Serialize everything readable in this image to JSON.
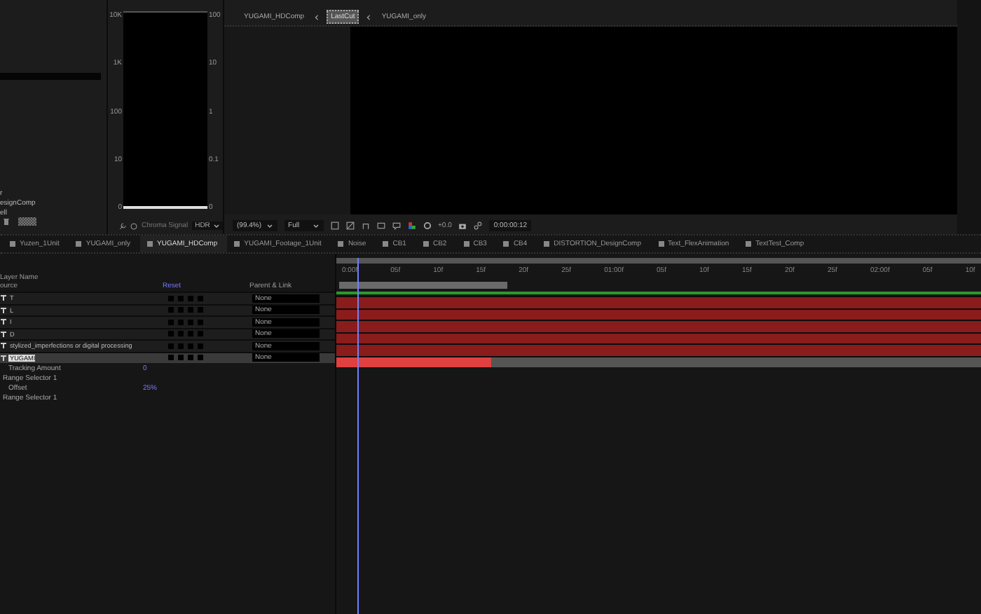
{
  "project_panel": {
    "items": [
      "r",
      "esignComp",
      "ell"
    ]
  },
  "scope": {
    "left_scale": [
      "10K",
      "1K",
      "100",
      "10",
      "0"
    ],
    "right_scale": [
      "100",
      "10",
      "1",
      "0.1",
      "0"
    ],
    "mode": "Chroma Signal",
    "range": "HDR"
  },
  "viewer": {
    "breadcrumbs": [
      {
        "label": "YUGAMI_HDComp",
        "selected": false
      },
      {
        "label": "LastCut",
        "selected": true
      },
      {
        "label": "YUGAMI_only",
        "selected": false
      }
    ],
    "zoom": "(99.4%)",
    "resolution": "Full",
    "exposure": "+0.0",
    "timecode": "0:00:00:12"
  },
  "comp_tabs": [
    {
      "label": "Yuzen_1Unit",
      "selected": false
    },
    {
      "label": "YUGAMI_only",
      "selected": false
    },
    {
      "label": "YUGAMI_HDComp",
      "selected": true
    },
    {
      "label": "YUGAMI_Footage_1Unit",
      "selected": false
    },
    {
      "label": "Noise",
      "selected": false
    },
    {
      "label": "CB1",
      "selected": false
    },
    {
      "label": "CB2",
      "selected": false
    },
    {
      "label": "CB3",
      "selected": false
    },
    {
      "label": "CB4",
      "selected": false
    },
    {
      "label": "DISTORTION_DesignComp",
      "selected": false
    },
    {
      "label": "Text_FlexAnimation",
      "selected": false
    },
    {
      "label": "TextTest_Comp",
      "selected": false
    }
  ],
  "timeline": {
    "layer_name_header": "Layer Name",
    "sub_header": "ource",
    "reset": "Reset",
    "parent_header": "Parent & Link",
    "layers": [
      {
        "name": "T",
        "parent": "None",
        "selected": false
      },
      {
        "name": "L",
        "parent": "None",
        "selected": false
      },
      {
        "name": "I",
        "parent": "None",
        "selected": false
      },
      {
        "name": "D",
        "parent": "None",
        "selected": false
      },
      {
        "name": "stylized_imperfections or digital processing",
        "parent": "None",
        "selected": false
      },
      {
        "name": "YUGAMI",
        "parent": "None",
        "selected": true
      }
    ],
    "properties": [
      {
        "kind": "property",
        "name": "Tracking Amount",
        "value": "0"
      },
      {
        "kind": "group",
        "name": "Range Selector 1"
      },
      {
        "kind": "property",
        "name": "Offset",
        "value": "25%"
      },
      {
        "kind": "group",
        "name": "Range Selector 1"
      }
    ],
    "ruler": [
      "0:00f",
      "05f",
      "10f",
      "15f",
      "20f",
      "25f",
      "01:00f",
      "05f",
      "10f",
      "15f",
      "20f",
      "25f",
      "02:00f",
      "05f",
      "10f"
    ]
  }
}
